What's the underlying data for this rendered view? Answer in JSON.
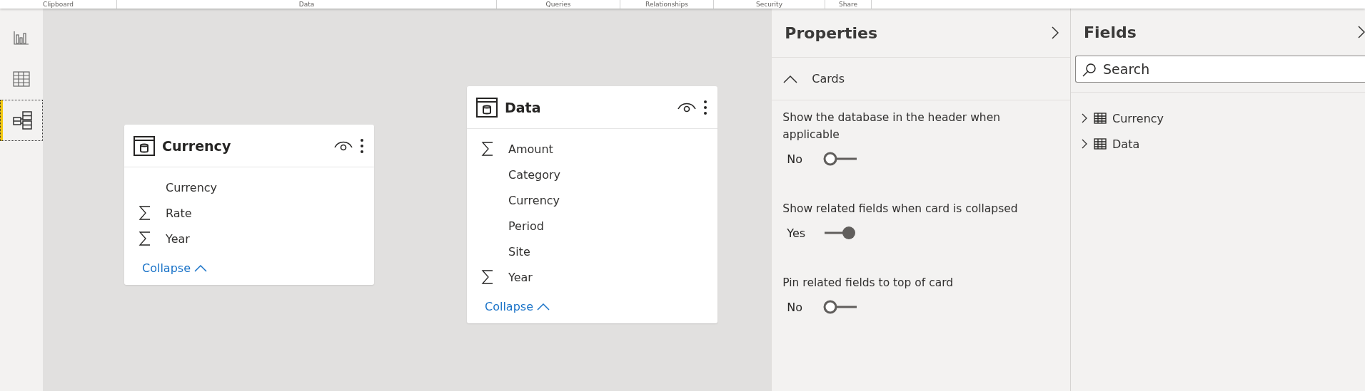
{
  "ribbon": {
    "groups": [
      "Clipboard",
      "Data",
      "Queries",
      "Relationships",
      "Security",
      "Share"
    ]
  },
  "nav": [
    {
      "kind": "report",
      "selected": false
    },
    {
      "kind": "table",
      "selected": false
    },
    {
      "kind": "model",
      "selected": true
    }
  ],
  "cards": [
    {
      "title": "Currency",
      "fields": [
        {
          "name": "Currency",
          "kind": "text"
        },
        {
          "name": "Rate",
          "kind": "sum"
        },
        {
          "name": "Year",
          "kind": "sum"
        }
      ],
      "collapse": "Collapse"
    },
    {
      "title": "Data",
      "fields": [
        {
          "name": "Amount",
          "kind": "sum"
        },
        {
          "name": "Category",
          "kind": "text"
        },
        {
          "name": "Currency",
          "kind": "text"
        },
        {
          "name": "Period",
          "kind": "text"
        },
        {
          "name": "Site",
          "kind": "text"
        },
        {
          "name": "Year",
          "kind": "sum"
        }
      ],
      "collapse": "Collapse"
    }
  ],
  "properties": {
    "title": "Properties",
    "section": {
      "label": "Cards",
      "expanded": true
    },
    "settings": [
      {
        "label": "Show the database in the header when applicable",
        "value": "No",
        "on": false
      },
      {
        "label": "Show related fields when card is collapsed",
        "value": "Yes",
        "on": true
      },
      {
        "label": "Pin related fields to top of card",
        "value": "No",
        "on": false
      }
    ]
  },
  "fields_pane": {
    "title": "Fields",
    "search": {
      "placeholder": "Search"
    },
    "tables": [
      {
        "name": "Currency",
        "expanded": false
      },
      {
        "name": "Data",
        "expanded": false
      }
    ]
  }
}
